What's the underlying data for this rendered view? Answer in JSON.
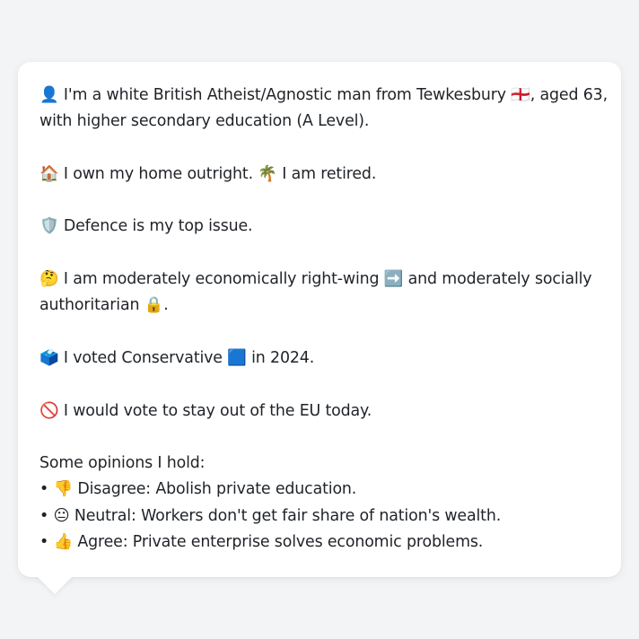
{
  "profile": {
    "intro_line1": "👤 I'm a white British Atheist/Agnostic man from Tewkesbury 🏴󠁧󠁢󠁥󠁮󠁧󠁿, aged 63,",
    "intro_line2": "with higher secondary education (A Level).",
    "home_line": "🏠 I own my home outright. 🌴 I am retired.",
    "issue_line": "🛡️ Defence is my top issue.",
    "ideology_line1": "🤔 I am moderately economically right-wing ➡️ and moderately socially",
    "ideology_line2": "authoritarian 🔒.",
    "vote_line": "🗳️ I voted Conservative 🟦 in 2024.",
    "eu_line": "🚫 I would vote to stay out of the EU today.",
    "opinions_heading": "Some opinions I hold:",
    "opinions": [
      "• 👎 Disagree: Abolish private education.",
      "• 😐 Neutral: Workers don't get fair share of nation's wealth.",
      "• 👍 Agree: Private enterprise solves economic problems."
    ]
  }
}
